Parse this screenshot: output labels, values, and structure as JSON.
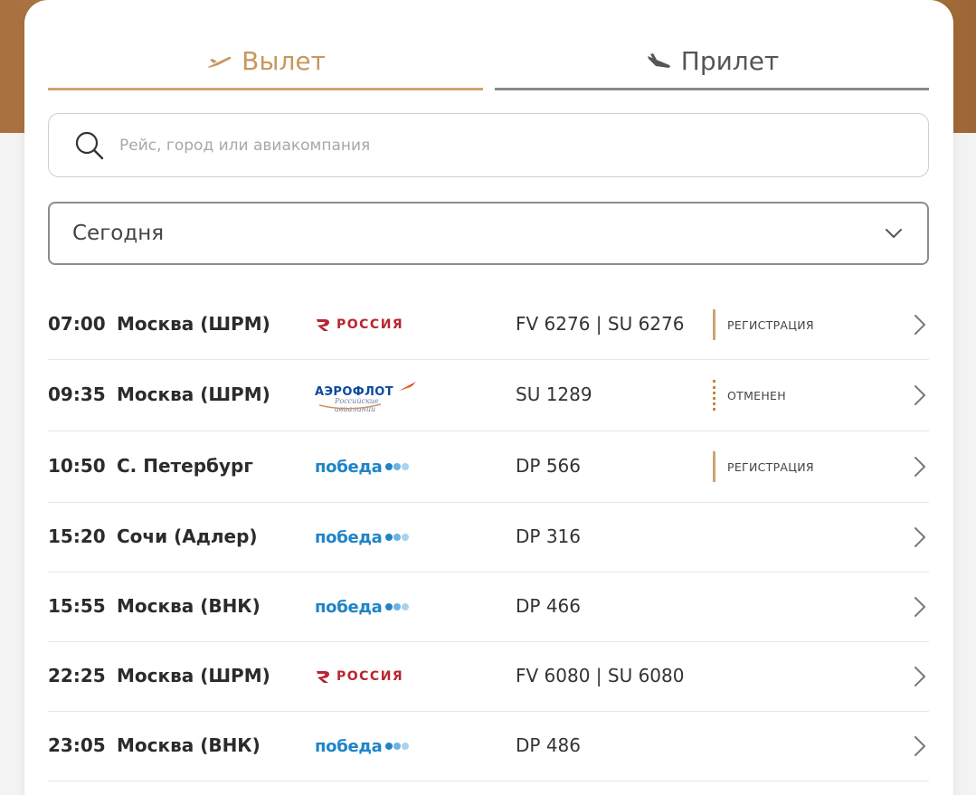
{
  "tabs": {
    "departures": {
      "label": "Вылет",
      "icon": "plane-takeoff-icon",
      "active": true
    },
    "arrivals": {
      "label": "Прилет",
      "icon": "plane-landing-icon",
      "active": false
    }
  },
  "search": {
    "placeholder": "Рейс, город или авиакомпания",
    "value": ""
  },
  "date_filter": {
    "selected": "Сегодня"
  },
  "flights": [
    {
      "time": "07:00",
      "city": "Москва (ШРМ)",
      "airline": "rossiya",
      "logo_text": "РОССИЯ",
      "flight": "FV 6276 | SU 6276",
      "status": "РЕГИСТРАЦИЯ"
    },
    {
      "time": "09:35",
      "city": "Москва (ШРМ)",
      "airline": "aeroflot",
      "logo_text": "АЭРОФЛОТ",
      "logo_sub": "Российские авиалинии",
      "flight": "SU 1289",
      "status": "ОТМЕНЕН"
    },
    {
      "time": "10:50",
      "city": "С. Петербург",
      "airline": "pobeda",
      "logo_text": "победа",
      "flight": "DP 566",
      "status": "РЕГИСТРАЦИЯ"
    },
    {
      "time": "15:20",
      "city": "Сочи (Адлер)",
      "airline": "pobeda",
      "logo_text": "победа",
      "flight": "DP 316",
      "status": ""
    },
    {
      "time": "15:55",
      "city": "Москва (ВНК)",
      "airline": "pobeda",
      "logo_text": "победа",
      "flight": "DP 466",
      "status": ""
    },
    {
      "time": "22:25",
      "city": "Москва (ШРМ)",
      "airline": "rossiya",
      "logo_text": "РОССИЯ",
      "flight": "FV 6080 | SU 6080",
      "status": ""
    },
    {
      "time": "23:05",
      "city": "Москва (ВНК)",
      "airline": "pobeda",
      "logo_text": "победа",
      "flight": "DP 486",
      "status": ""
    }
  ],
  "colors": {
    "accent": "#c9975d",
    "rossiya_red": "#b8262f",
    "pobeda_blue": "#1f84c7",
    "aeroflot_blue": "#0b4aa0"
  }
}
